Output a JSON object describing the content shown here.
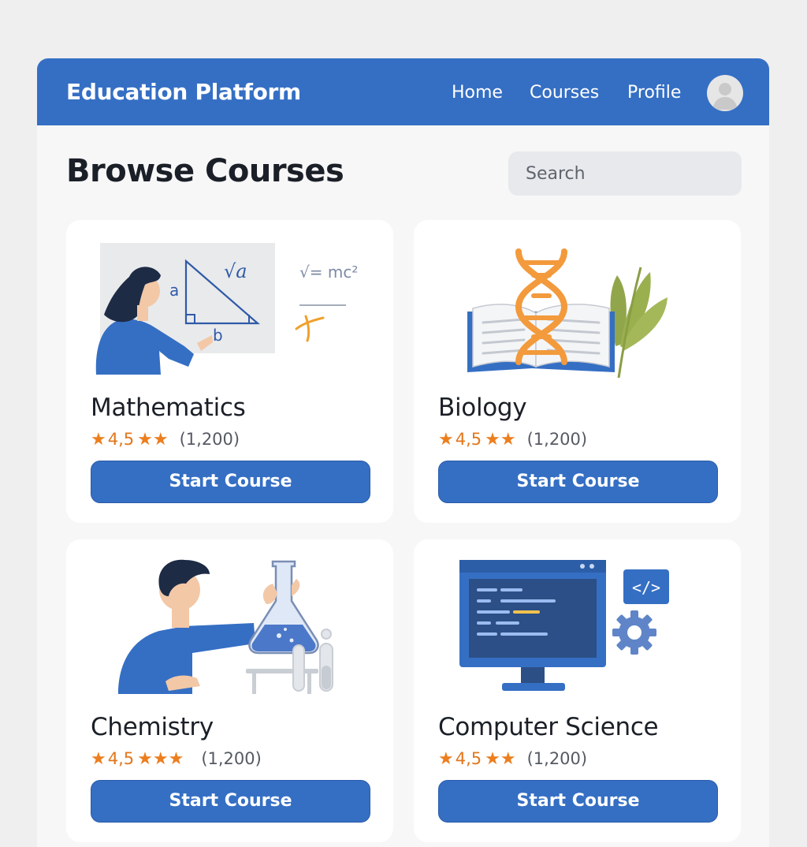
{
  "header": {
    "brand": "Education Platform",
    "nav": [
      "Home",
      "Courses",
      "Profile"
    ]
  },
  "main": {
    "title": "Browse Courses",
    "search_placeholder": "Search"
  },
  "courses": [
    {
      "title": "Mathematics",
      "rating": "4,5",
      "count": "(1,200)",
      "button": "Start Course",
      "icon": "math-illustration",
      "board_text": "√a",
      "formula": "√= mc²",
      "side_a": "a",
      "side_b": "b"
    },
    {
      "title": "Biology",
      "rating": "4,5",
      "count": "(1,200)",
      "button": "Start Course",
      "icon": "dna-book-illustration"
    },
    {
      "title": "Chemistry",
      "rating": "4,5",
      "count": "(1,200)",
      "button": "Start Course",
      "icon": "flask-illustration"
    },
    {
      "title": "Computer Science",
      "rating": "4,5",
      "count": "(1,200)",
      "button": "Start Course",
      "icon": "computer-code-illustration",
      "code_tag": "</>"
    }
  ],
  "colors": {
    "primary": "#356fc4",
    "star": "#ec7e1e",
    "background": "#efefef"
  }
}
